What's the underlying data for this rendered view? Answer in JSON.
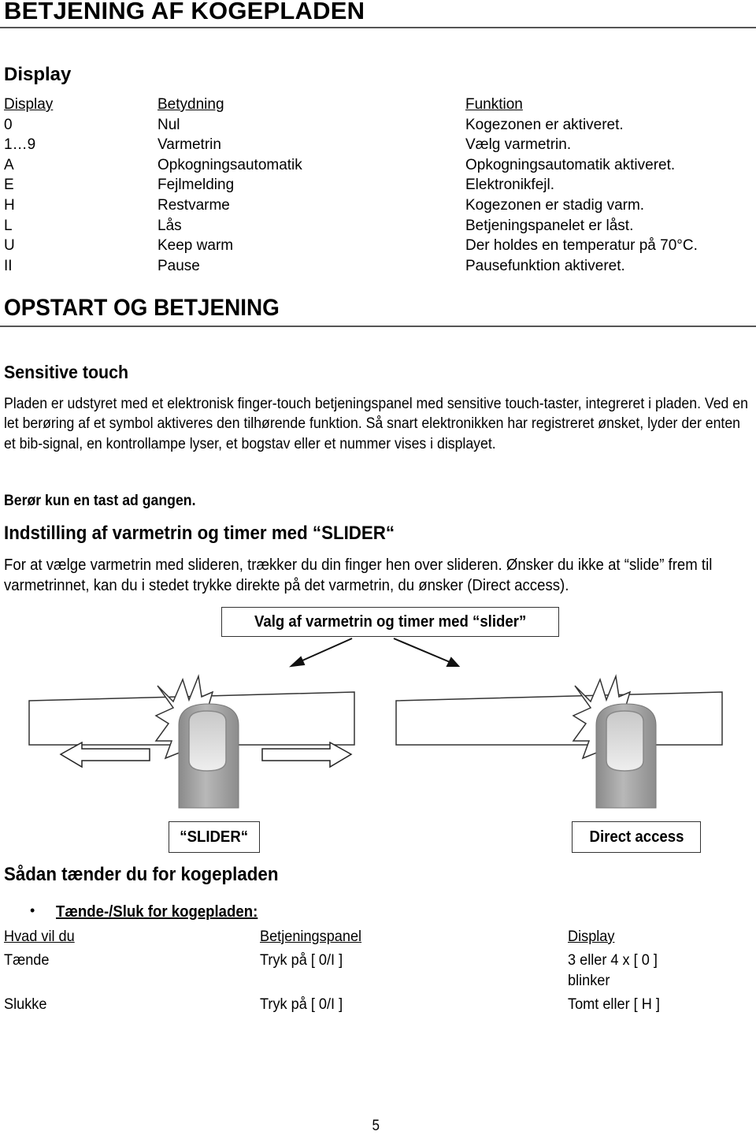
{
  "page_title": "BETJENING AF KOGEPLADEN",
  "display_section": {
    "heading": "Display",
    "columns": [
      "Display",
      "Betydning",
      "Funktion"
    ],
    "rows": [
      {
        "display": "0",
        "meaning": "Nul",
        "function": "Kogezonen er aktiveret."
      },
      {
        "display": "1…9",
        "meaning": "Varmetrin",
        "function": "Vælg varmetrin."
      },
      {
        "display": "A",
        "meaning": "Opkogningsautomatik",
        "function": "Opkogningsautomatik aktiveret."
      },
      {
        "display": "E",
        "meaning": "Fejlmelding",
        "function": "Elektronikfejl."
      },
      {
        "display": "H",
        "meaning": "Restvarme",
        "function": "Kogezonen er stadig varm."
      },
      {
        "display": "L",
        "meaning": "Lås",
        "function": "Betjeningspanelet er låst."
      },
      {
        "display": "U",
        "meaning": "Keep warm",
        "function": "Der holdes en temperatur på 70°C."
      },
      {
        "display": "II",
        "meaning": "Pause",
        "function": "Pausefunktion aktiveret."
      }
    ]
  },
  "startup_section": {
    "title": "OPSTART OG BETJENING",
    "sensitive_touch": {
      "heading": "Sensitive touch",
      "paragraph": "Pladen er udstyret med et elektronisk finger-touch betjeningspanel med sensitive touch-taster, integreret i pladen. Ved en let berøring af et symbol aktiveres den tilhørende funktion. Så snart elektronikken har registreret ønsket, lyder der enten et bib-signal, en kontrollampe lyser, et bogstav eller et nummer vises i displayet.",
      "note": "Berør kun en tast ad gangen."
    },
    "slider": {
      "heading": "Indstilling af varmetrin og timer med “SLIDER“",
      "paragraph": "For at vælge varmetrin med slideren, trækker du din finger hen over slideren. Ønsker du ikke at “slide” frem til varmetrinnet, kan du i stedet trykke direkte på det varmetrin, du ønsker (Direct access).",
      "diagram": {
        "top_label": "Valg af varmetrin og timer med “slider”",
        "left_label": "“SLIDER“",
        "right_label": "Direct access",
        "colors": {
          "finger": "#a9a9a9",
          "nail": "#dcdcdc",
          "outline": "#333333"
        }
      }
    },
    "turn_on": {
      "heading": "Sådan tænder du for kogepladen",
      "bullet": "Tænde-/Sluk for kogepladen:",
      "columns": [
        "Hvad vil du",
        "Betjeningspanel",
        "Display"
      ],
      "rows": [
        {
          "action": "Tænde",
          "panel": "Tryk på [ 0/I ]",
          "display": "3 eller 4 x [ 0 ]",
          "display_line2": "blinker"
        },
        {
          "action": "Slukke",
          "panel": "Tryk på [ 0/I ]",
          "display": "Tomt eller [ H ]",
          "display_line2": ""
        }
      ]
    }
  },
  "page_number": "5"
}
